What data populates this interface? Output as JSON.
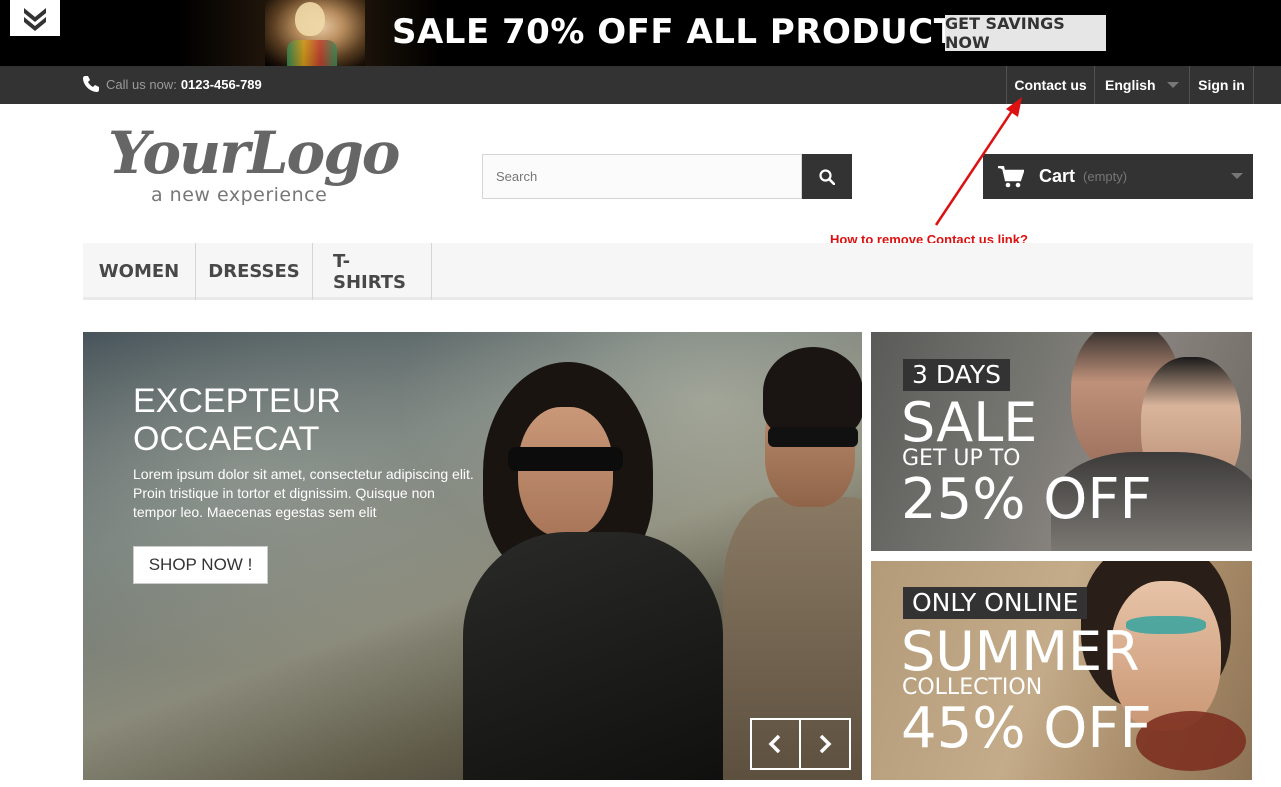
{
  "promo": {
    "text": "SALE 70% OFF ALL PRODUCTS",
    "button": "GET SAVINGS NOW"
  },
  "navbar": {
    "call_label": "Call us now:",
    "phone": "0123-456-789",
    "contact": "Contact us",
    "language": "English",
    "signin": "Sign in"
  },
  "logo": {
    "main": "YourLogo",
    "tagline": "a new experience"
  },
  "search": {
    "placeholder": "Search"
  },
  "cart": {
    "label": "Cart",
    "status": "(empty)"
  },
  "annotation": {
    "text": "How to remove Contact us link?",
    "color": "#dd1111"
  },
  "menu": {
    "items": [
      "WOMEN",
      "DRESSES",
      "T-SHIRTS"
    ]
  },
  "slider": {
    "title_line1": "EXCEPTEUR",
    "title_line2": "OCCAECAT",
    "text": "Lorem ipsum dolor sit amet, consectetur adipiscing elit. Proin tristique in tortor et dignissim. Quisque non tempor leo. Maecenas egestas sem elit",
    "button": "SHOP NOW !"
  },
  "banners": [
    {
      "tag": "3 DAYS",
      "big": "SALE",
      "mid": "GET UP TO",
      "pct": "25% OFF"
    },
    {
      "tag": "ONLY ONLINE",
      "big": "SUMMER",
      "mid": "COLLECTION",
      "pct": "45% OFF"
    }
  ]
}
